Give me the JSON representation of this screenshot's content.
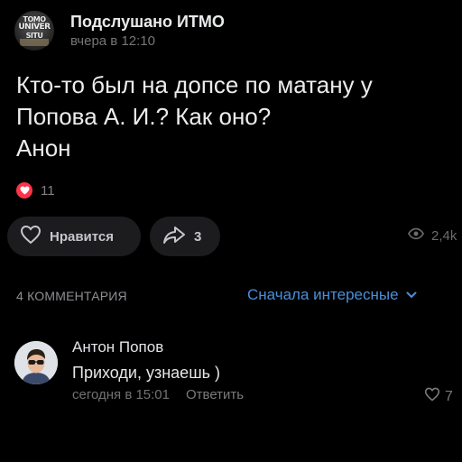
{
  "post": {
    "group_name": "Подслушано ИТМО",
    "time": "вчера в 12:10",
    "avatar_logo_lines": [
      "TOMO",
      "UNIVER",
      "SITU"
    ],
    "text_lines": [
      "Кто-то был на допсе по матану у",
      "Попова А. И.? Как оно?",
      "Анон"
    ],
    "reaction_icon": "heart-icon",
    "reaction_count": "11",
    "like_label": "Нравится",
    "share_count": "3",
    "views": "2,4k"
  },
  "comments": {
    "count_label": "4 КОММЕНТАРИЯ",
    "sort_label": "Сначала интересные",
    "items": [
      {
        "author": "Антон Попов",
        "text": "Приходи, узнаешь )",
        "time": "сегодня в 15:01",
        "reply_label": "Ответить",
        "likes": "7"
      }
    ]
  },
  "colors": {
    "background": "#000000",
    "accent_blue": "#4a8fd9",
    "heart_red": "#ff3347",
    "button_bg": "#1c1c1e"
  }
}
